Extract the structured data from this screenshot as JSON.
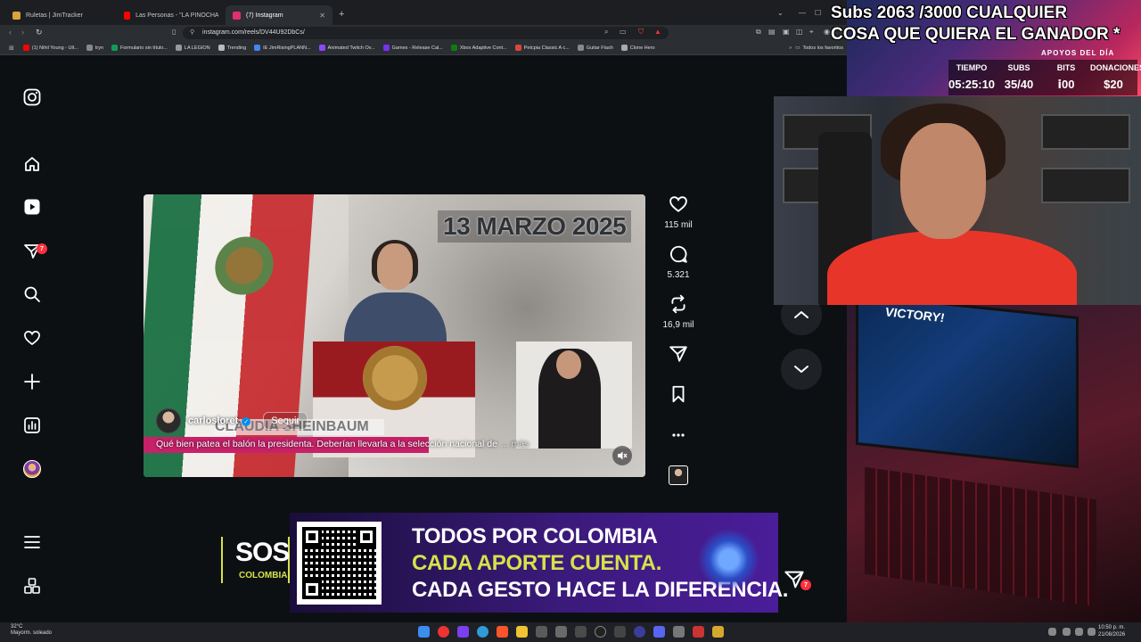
{
  "browser": {
    "tabs": [
      {
        "label": "Ruletas | JimTracker",
        "color": "#d9a23a"
      },
      {
        "label": "Las Personas - \"LA PINOCHA\" - YouT",
        "color": "#ff0000"
      },
      {
        "label": "(7) Instagram",
        "color": "#e1306c"
      }
    ],
    "url": "instagram.com/reels/DV44U92DbCs/",
    "bookmarks": [
      {
        "label": "(1) Nihil Young - Ult...",
        "color": "#ff0000"
      },
      {
        "label": "tryn",
        "color": "#888888"
      },
      {
        "label": "Formulario sin título...",
        "color": "#0f9d58"
      },
      {
        "label": "LA LEGION",
        "color": "#999999"
      },
      {
        "label": "Trending",
        "color": "#bbbbbb"
      },
      {
        "label": "IE JimRisingPLANN...",
        "color": "#4285f4"
      },
      {
        "label": "Animated Twitch Ov...",
        "color": "#9146ff"
      },
      {
        "label": "Games - Release Cal...",
        "color": "#7b2ff7"
      },
      {
        "label": "Xbox Adaptive Cont...",
        "color": "#107c10"
      },
      {
        "label": "Petcpia Classic A c...",
        "color": "#d9473a"
      },
      {
        "label": "Guitar Flash",
        "color": "#888888"
      },
      {
        "label": "Clone Hero",
        "color": "#aaaaaa"
      }
    ],
    "all_favorites": "Todos los favoritos"
  },
  "sidebar": {
    "notification_count": "7",
    "items": [
      "instagram-logo",
      "home",
      "reels",
      "messages",
      "search",
      "notifications",
      "create",
      "dashboard",
      "profile",
      "more",
      "also-from-meta"
    ]
  },
  "reel": {
    "date_overlay": "13 MARZO 2025",
    "name_overlay": "CLAUDIA SHEINBAUM",
    "author": "carlosloret",
    "follow_label": "Seguir",
    "caption": "Qué bien patea el balón la presidenta. Deberían llevarla a la selección nacional de",
    "more_label": "... más",
    "likes": "115 mil",
    "comments": "5.321",
    "reposts": "16,9 mil"
  },
  "banner": {
    "logo_main": "SOS",
    "logo_sub": "COLOMBIA",
    "line1": "TODOS POR COLOMBIA",
    "line2": "CADA APORTE CUENTA.",
    "line3": "CADA GESTO HACE LA DIFERENCIA.",
    "line1_color": "#ffffff",
    "line2_color": "#d6e24a",
    "line3_color": "#ffffff"
  },
  "overlay": {
    "sub_goal_line1": "Subs 2063 /3000 CUALQUIER",
    "sub_goal_line2": "COSA QUE QUIERA EL GANADOR *",
    "support_title": "APOYOS DEL DÍA",
    "stats": [
      {
        "label": "TIEMPO",
        "value": "05:25:10"
      },
      {
        "label": "SUBS",
        "value": "35/40"
      },
      {
        "label": "BITS",
        "value": "ⅰ00"
      },
      {
        "label": "DONACIONES",
        "value": "$20"
      }
    ],
    "game_text": "VICTORY!"
  },
  "taskbar": {
    "weather_temp": "32°C",
    "weather_desc": "Mayorm. soleado",
    "time": "10:50 p. m.",
    "date": "21/08/2026"
  }
}
